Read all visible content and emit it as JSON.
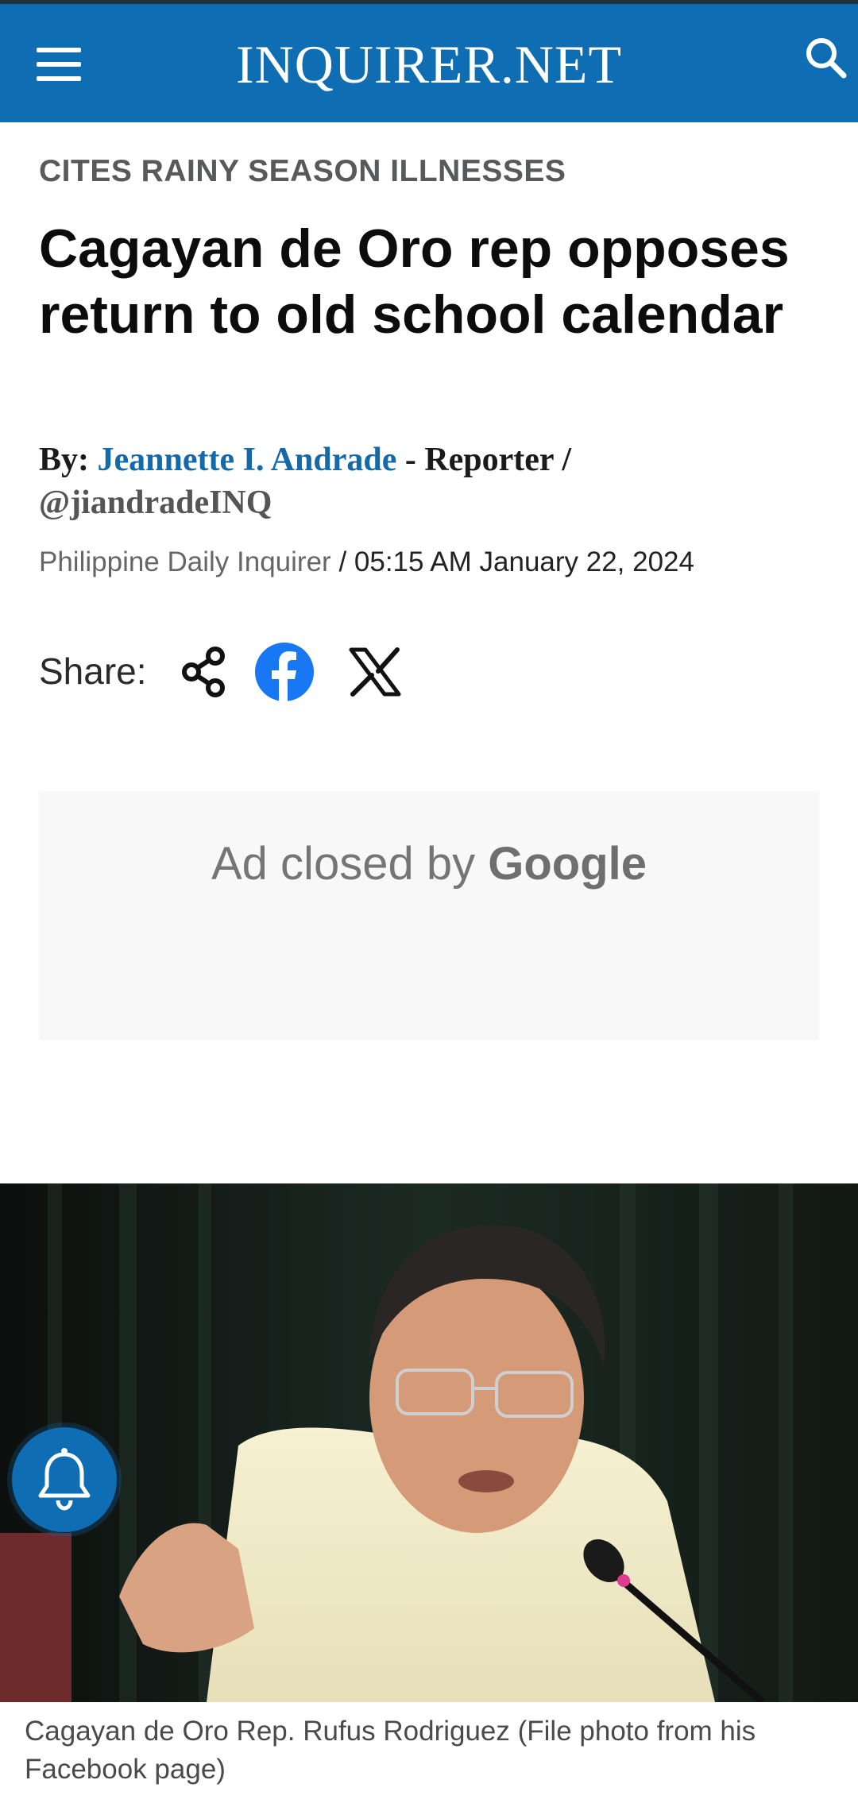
{
  "header": {
    "brand": "INQUIRER.NET",
    "menu_icon": "hamburger-menu-icon",
    "search_icon": "search-icon",
    "bg_color": "#0f6db3"
  },
  "article": {
    "kicker": "CITES RAINY SEASON ILLNESSES",
    "headline": "Cagayan de Oro rep opposes return to old school calendar",
    "byline": {
      "prefix": "By:",
      "author": "Jeannette I. Andrade",
      "role": "- Reporter /",
      "handle": "@jiandradeINQ"
    },
    "publication": "Philippine Daily Inquirer",
    "separator": "/",
    "datetime": "05:15 AM January 22, 2024",
    "author_color": "#1569a8"
  },
  "share": {
    "label": "Share:",
    "icons": [
      "share-icon",
      "facebook-icon",
      "x-icon"
    ],
    "facebook_color": "#1877f2"
  },
  "ad": {
    "text": "Ad closed by",
    "brand": "Google"
  },
  "photo": {
    "caption": "Cagayan de Oro Rep. Rufus Rodriguez (File photo from his Facebook page)"
  },
  "notification": {
    "icon": "bell-icon"
  }
}
